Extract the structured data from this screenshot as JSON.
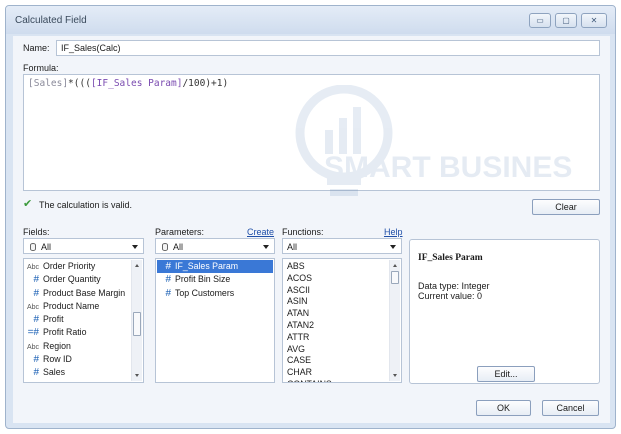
{
  "window": {
    "title": "Calculated Field",
    "minimize_glyph": "▭",
    "maximize_glyph": "▢",
    "close_glyph": "✕"
  },
  "name": {
    "label": "Name:",
    "value": "IF_Sales(Calc)"
  },
  "formula": {
    "label": "Formula:",
    "part_field": "[Sales]",
    "part_op1": "*(((",
    "part_param": "[IF_Sales Param]",
    "part_op2": "/100)+1)"
  },
  "status": {
    "message": "The calculation is valid.",
    "icon": "check-icon",
    "color": "#3c9a3c"
  },
  "clear_button": "Clear",
  "fields": {
    "label": "Fields:",
    "filter": "All",
    "items": [
      {
        "type": "Abc",
        "name": "Order Priority"
      },
      {
        "type": "#",
        "name": "Order Quantity"
      },
      {
        "type": "#",
        "name": "Product Base Margin"
      },
      {
        "type": "Abc",
        "name": "Product Name"
      },
      {
        "type": "#",
        "name": "Profit"
      },
      {
        "type": "=#",
        "name": "Profit Ratio"
      },
      {
        "type": "Abc",
        "name": "Region"
      },
      {
        "type": "#",
        "name": "Row ID"
      },
      {
        "type": "#",
        "name": "Sales"
      }
    ]
  },
  "parameters": {
    "label": "Parameters:",
    "create_link": "Create",
    "filter": "All",
    "items": [
      {
        "type": "#",
        "name": "IF_Sales Param",
        "selected": true
      },
      {
        "type": "#",
        "name": "Profit Bin Size"
      },
      {
        "type": "#",
        "name": "Top Customers"
      }
    ]
  },
  "functions": {
    "label": "Functions:",
    "help_link": "Help",
    "filter": "All",
    "items": [
      "ABS",
      "ACOS",
      "ASCII",
      "ASIN",
      "ATAN",
      "ATAN2",
      "ATTR",
      "AVG",
      "CASE",
      "CHAR",
      "CONTAINS"
    ]
  },
  "info": {
    "title": "IF_Sales Param",
    "data_type": "Data type: Integer",
    "current_value": "Current value: 0",
    "edit_button": "Edit..."
  },
  "buttons": {
    "ok": "OK",
    "cancel": "Cancel"
  },
  "watermark": {
    "text": "SMART BUSINESS"
  },
  "colors": {
    "accent": "#3a78d6",
    "link": "#1f4fa8",
    "param_text": "#7a4bb0"
  }
}
